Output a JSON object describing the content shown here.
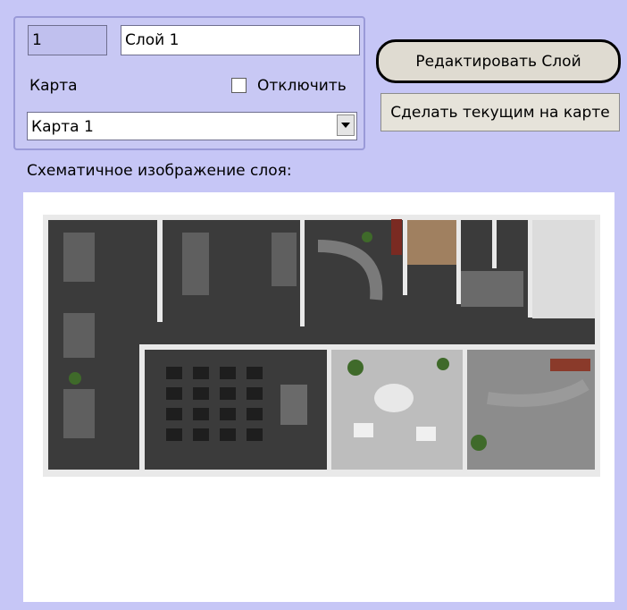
{
  "layer": {
    "id_value": "1",
    "name_value": "Слой 1",
    "map_label": "Карта",
    "disable_label": "Отключить",
    "map_select_value": "Карта 1"
  },
  "buttons": {
    "edit_layer": "Редактировать Слой",
    "make_current": "Сделать текущим на карте"
  },
  "preview": {
    "label": "Схематичное изображение слоя:"
  },
  "colors": {
    "background": "#c6c6f6",
    "group_border": "#9a9ad8",
    "button_face": "#e6e3da"
  }
}
